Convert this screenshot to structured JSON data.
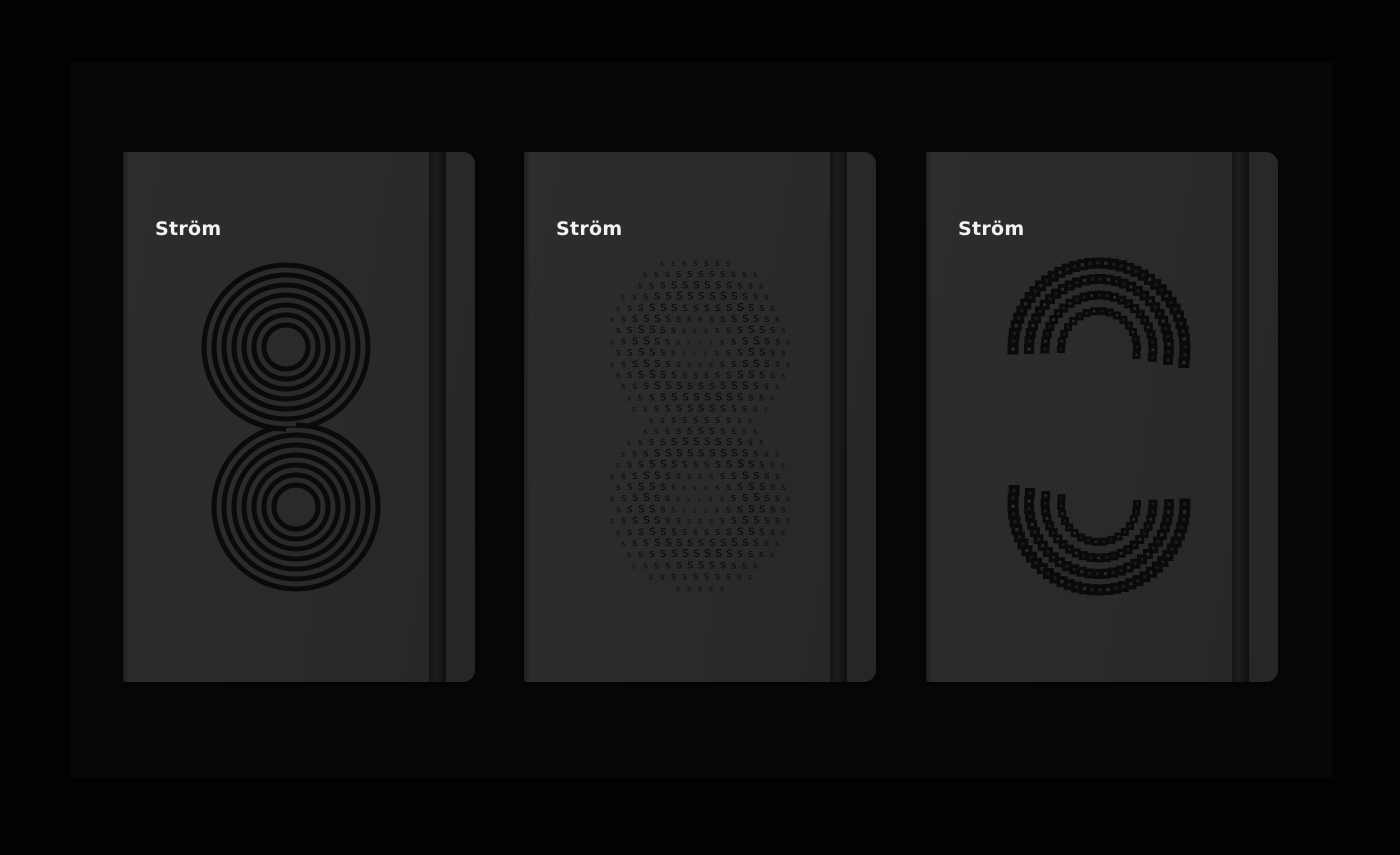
{
  "notebooks": [
    {
      "brand": "Ström",
      "pattern": "concentric-lines-s"
    },
    {
      "brand": "Ström",
      "pattern": "letter-s-dots"
    },
    {
      "brand": "Ström",
      "pattern": "dice-tiles-s"
    }
  ],
  "colors": {
    "background": "#000000",
    "cover": "#2b2b2b",
    "emboss": "#0a0a0a",
    "brand_text": "#f2f2f2"
  }
}
